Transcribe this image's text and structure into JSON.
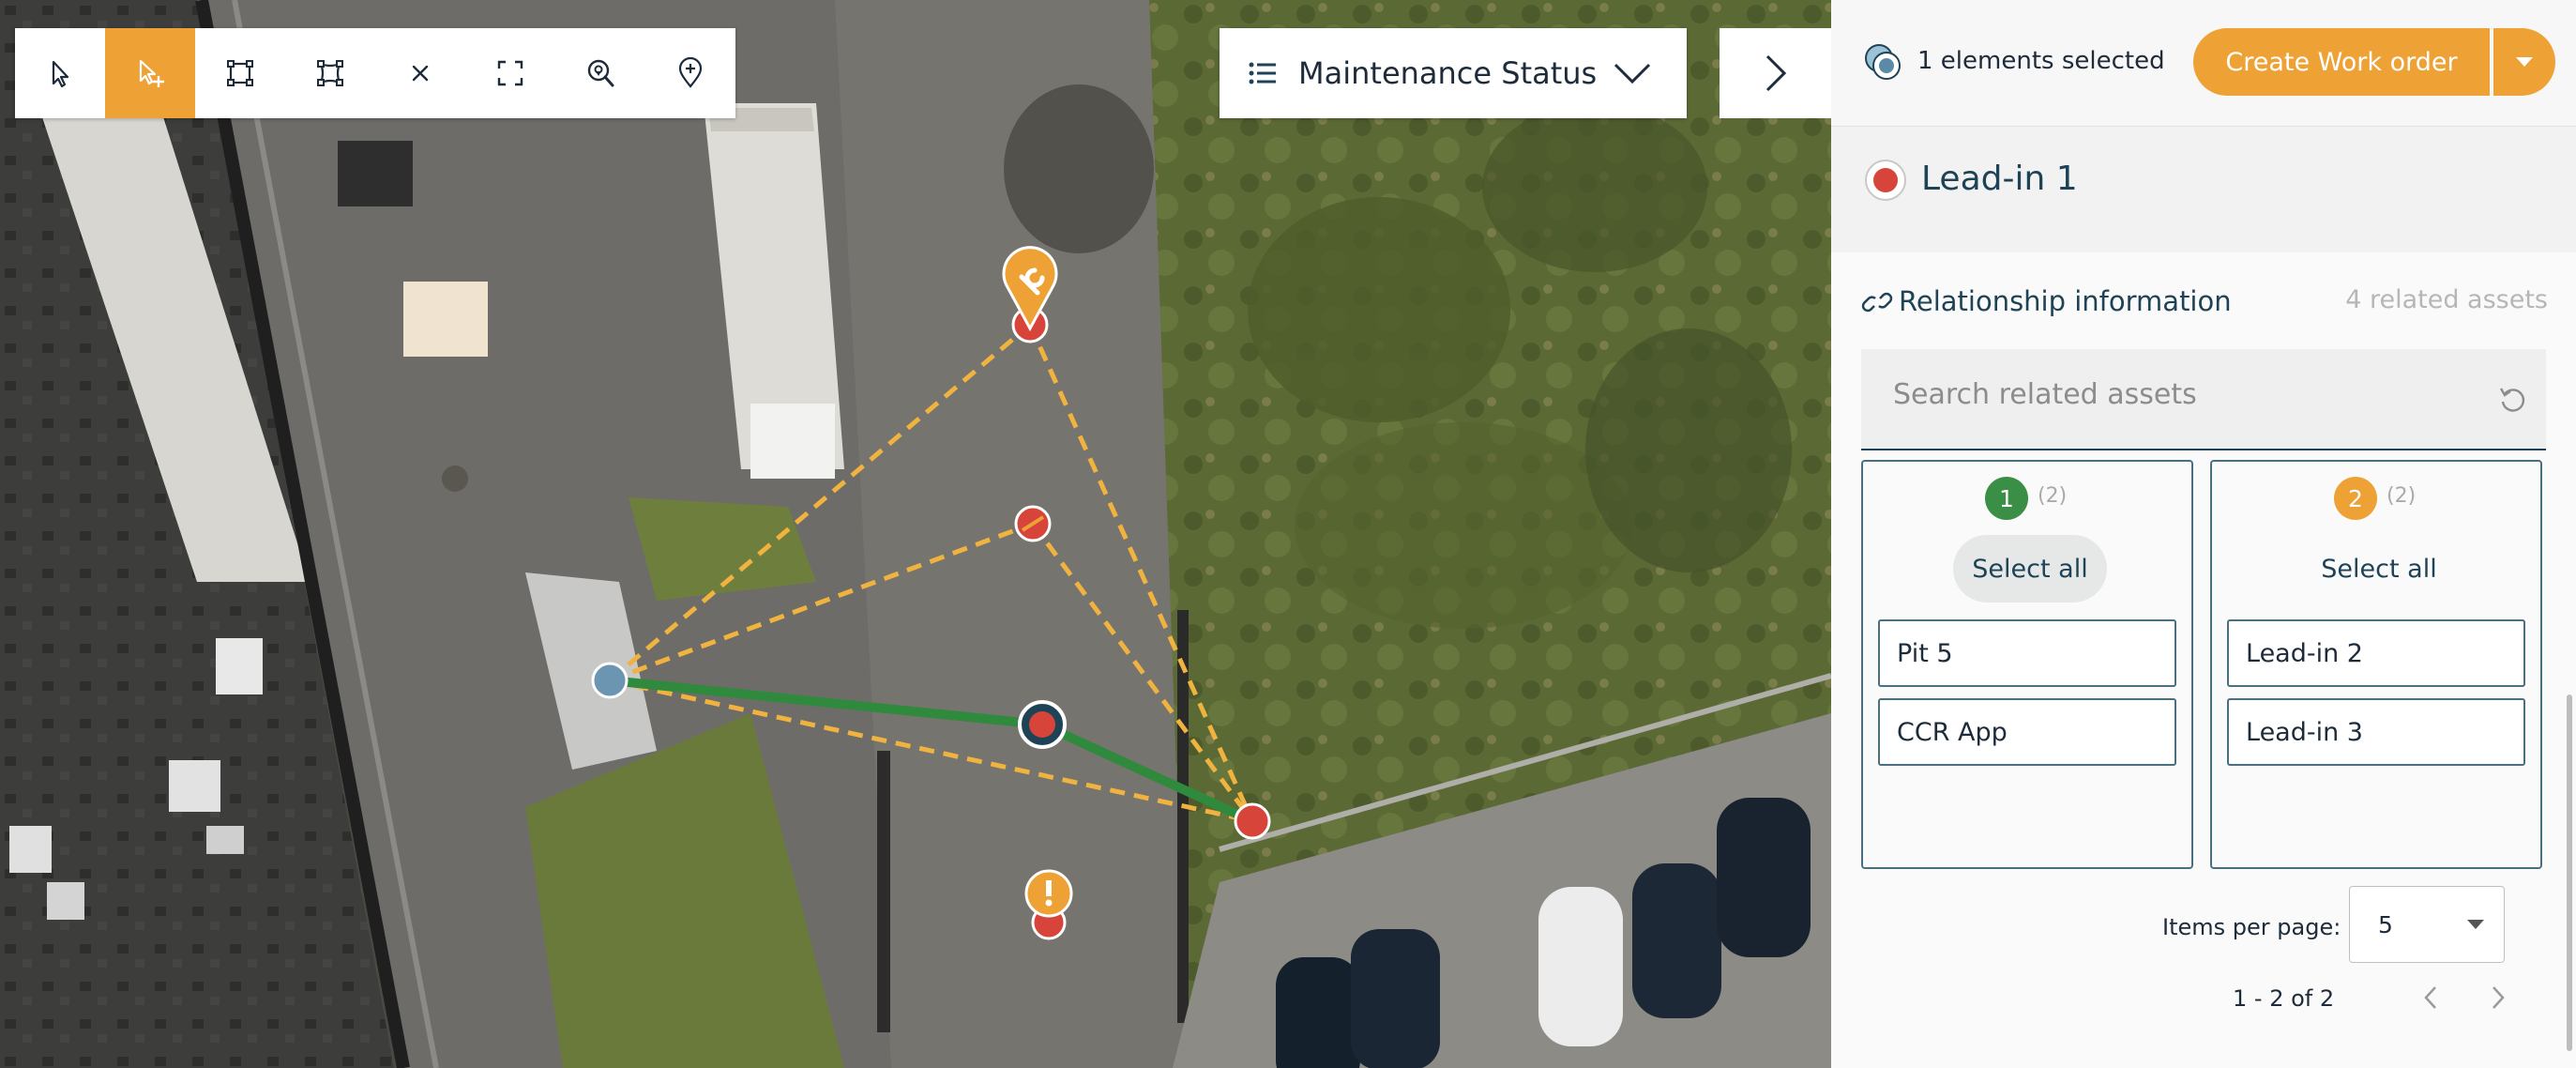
{
  "toolbar": {
    "tools": [
      "select-icon",
      "add-select-icon",
      "rectangle-select-icon",
      "polygon-select-icon",
      "clear-icon",
      "fit-extent-icon",
      "zoom-to-icon",
      "add-marker-icon"
    ],
    "active_tool": "add-select-icon"
  },
  "layer_selector": {
    "label": "Maintenance Status",
    "icon": "list-icon"
  },
  "panel_toggle": {
    "icon": "chevron-right-icon"
  },
  "colors": {
    "accent": "#EEA236",
    "dark_blue": "#1E4356",
    "green": "#3A8E45",
    "red": "#D6443A",
    "line_green": "#2F8A3D",
    "dashed_orange": "#F0B33F"
  },
  "panel": {
    "selection_text": "1 elements selected",
    "create_button": "Create Work order",
    "asset_title": "Lead-in 1",
    "relationship": {
      "title": "Relationship information",
      "count_text": "4 related assets"
    },
    "search": {
      "placeholder": "Search related assets"
    },
    "groups": [
      {
        "badge": "1",
        "count": "(2)",
        "select_all": "Select all",
        "items": [
          "Pit 5",
          "CCR App"
        ]
      },
      {
        "badge": "2",
        "count": "(2)",
        "select_all": "Select all",
        "items": [
          "Lead-in 2",
          "Lead-in 3"
        ]
      }
    ],
    "pager": {
      "label": "Items per page:",
      "value": "5",
      "range": "1 - 2 of 2"
    }
  }
}
